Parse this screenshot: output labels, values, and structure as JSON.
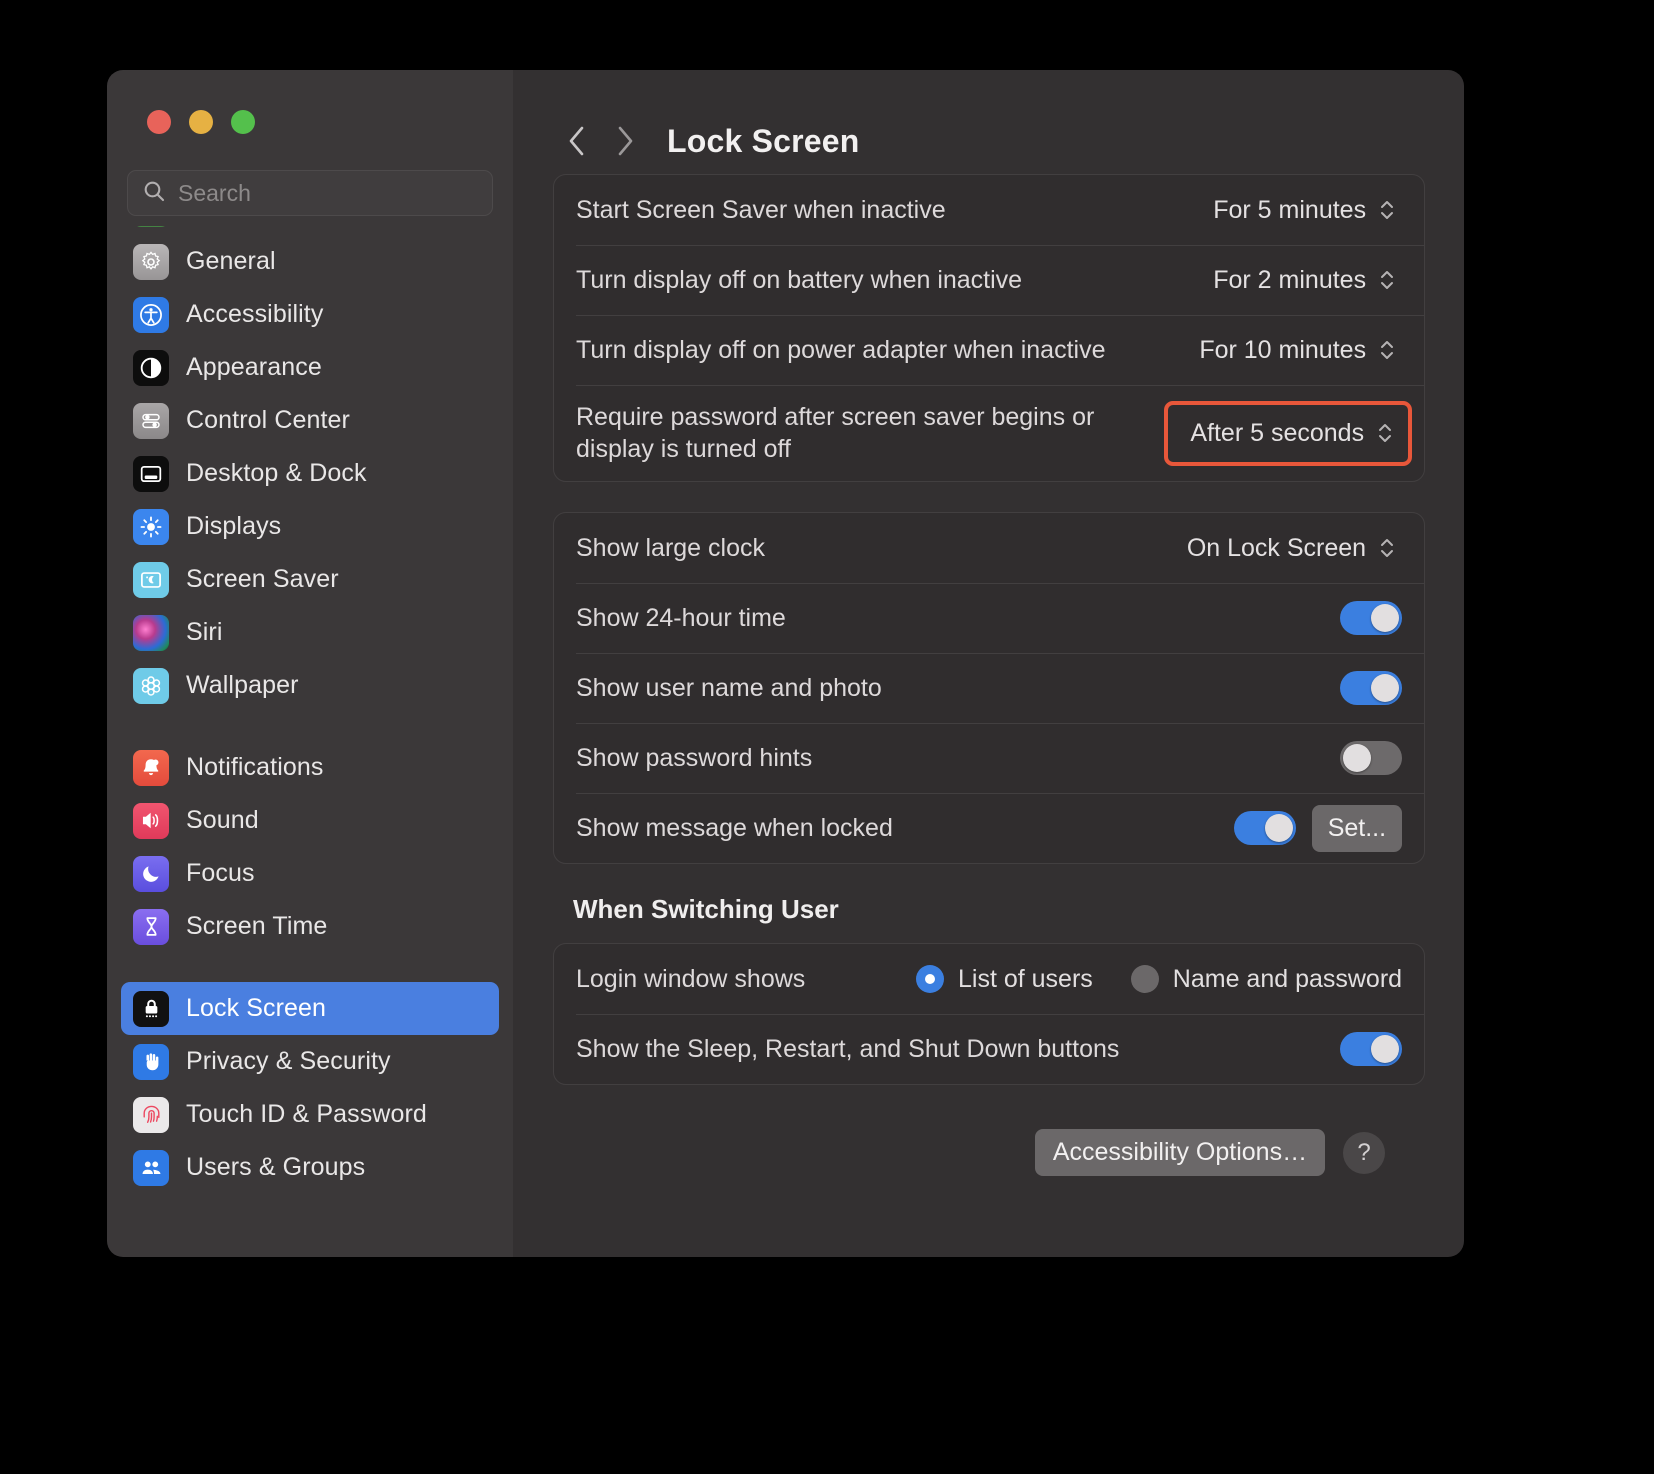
{
  "window": {
    "traffic_lights": [
      "close",
      "minimize",
      "zoom"
    ],
    "colors": {
      "close": "#e8635a",
      "minimize": "#e6b143",
      "zoom": "#54c04c",
      "accent": "#3b7fe0",
      "annotation": "#e8573a",
      "selected": "#4a7fe0"
    }
  },
  "sidebar": {
    "search": {
      "placeholder": "Search",
      "value": "",
      "icon": "search-icon"
    },
    "items": [
      {
        "label": "General",
        "icon": "gear-icon",
        "selected": false
      },
      {
        "label": "Accessibility",
        "icon": "accessibility-icon",
        "selected": false
      },
      {
        "label": "Appearance",
        "icon": "appearance-icon",
        "selected": false
      },
      {
        "label": "Control Center",
        "icon": "control-center-icon",
        "selected": false
      },
      {
        "label": "Desktop & Dock",
        "icon": "desktop-dock-icon",
        "selected": false
      },
      {
        "label": "Displays",
        "icon": "brightness-icon",
        "selected": false
      },
      {
        "label": "Screen Saver",
        "icon": "screen-saver-icon",
        "selected": false
      },
      {
        "label": "Siri",
        "icon": "siri-icon",
        "selected": false
      },
      {
        "label": "Wallpaper",
        "icon": "wallpaper-icon",
        "selected": false
      },
      {
        "label": "Notifications",
        "icon": "bell-icon",
        "selected": false,
        "group_start": true
      },
      {
        "label": "Sound",
        "icon": "speaker-icon",
        "selected": false
      },
      {
        "label": "Focus",
        "icon": "moon-icon",
        "selected": false
      },
      {
        "label": "Screen Time",
        "icon": "hourglass-icon",
        "selected": false
      },
      {
        "label": "Lock Screen",
        "icon": "lock-icon",
        "selected": true,
        "group_start": true
      },
      {
        "label": "Privacy & Security",
        "icon": "hand-icon",
        "selected": false
      },
      {
        "label": "Touch ID & Password",
        "icon": "fingerprint-icon",
        "selected": false
      },
      {
        "label": "Users & Groups",
        "icon": "users-icon",
        "selected": false
      }
    ]
  },
  "header": {
    "back_icon": "chevron-left-icon",
    "forward_icon": "chevron-right-icon",
    "title": "Lock Screen"
  },
  "group1": {
    "rows": [
      {
        "label": "Start Screen Saver when inactive",
        "value": "For 5 minutes",
        "highlighted": false
      },
      {
        "label": "Turn display off on battery when inactive",
        "value": "For 2 minutes",
        "highlighted": false
      },
      {
        "label": "Turn display off on power adapter when inactive",
        "value": "For 10 minutes",
        "highlighted": false
      },
      {
        "label": "Require password after screen saver begins or display is turned off",
        "value": "After 5 seconds",
        "highlighted": true
      }
    ]
  },
  "group2": {
    "clock_row": {
      "label": "Show large clock",
      "value": "On Lock Screen"
    },
    "toggle_rows": [
      {
        "label": "Show 24-hour time",
        "state": "on"
      },
      {
        "label": "Show user name and photo",
        "state": "on"
      },
      {
        "label": "Show password hints",
        "state": "off"
      },
      {
        "label": "Show message when locked",
        "state": "on",
        "button": "Set..."
      }
    ]
  },
  "switching_user": {
    "title": "When Switching User",
    "login_row": {
      "label": "Login window shows",
      "options": [
        {
          "label": "List of users",
          "selected": true
        },
        {
          "label": "Name and password",
          "selected": false
        }
      ]
    },
    "sleep_row": {
      "label": "Show the Sleep, Restart, and Shut Down buttons",
      "state": "on"
    }
  },
  "footer": {
    "accessibility_button": "Accessibility Options…",
    "help_button": "?"
  },
  "annotation": {
    "type": "arrow",
    "points_to": "Show message when locked",
    "color": "#e8573a"
  }
}
